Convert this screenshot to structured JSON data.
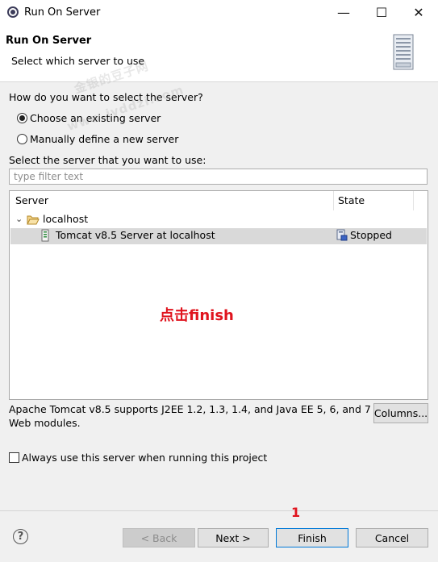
{
  "window": {
    "title": "Run On Server",
    "minimize": "—",
    "maximize": "☐",
    "close": "✕"
  },
  "header": {
    "title": "Run On Server",
    "subtitle": "Select which server to use"
  },
  "question": "How do you want to select the server?",
  "radios": {
    "existing": "Choose an existing server",
    "manual": "Manually define a new server"
  },
  "select_label": "Select the server that you want to use:",
  "filter": {
    "placeholder": "type filter text",
    "value": ""
  },
  "table": {
    "columns": [
      "Server",
      "State"
    ],
    "group": "localhost",
    "rows": [
      {
        "server": "Tomcat v8.5 Server at localhost",
        "state": "Stopped"
      }
    ]
  },
  "annotation": "点击finish",
  "step_number": "1",
  "description": "Apache Tomcat v8.5 supports J2EE 1.2, 1.3, 1.4, and Java EE 5, 6, and 7 Web modules.",
  "columns_button": "Columns...",
  "always_use": "Always use this server when running this project",
  "buttons": {
    "back": "< Back",
    "next": "Next >",
    "finish": "Finish",
    "cancel": "Cancel"
  },
  "watermark": [
    "金银的豆子网",
    "www.jyddzi.com"
  ]
}
